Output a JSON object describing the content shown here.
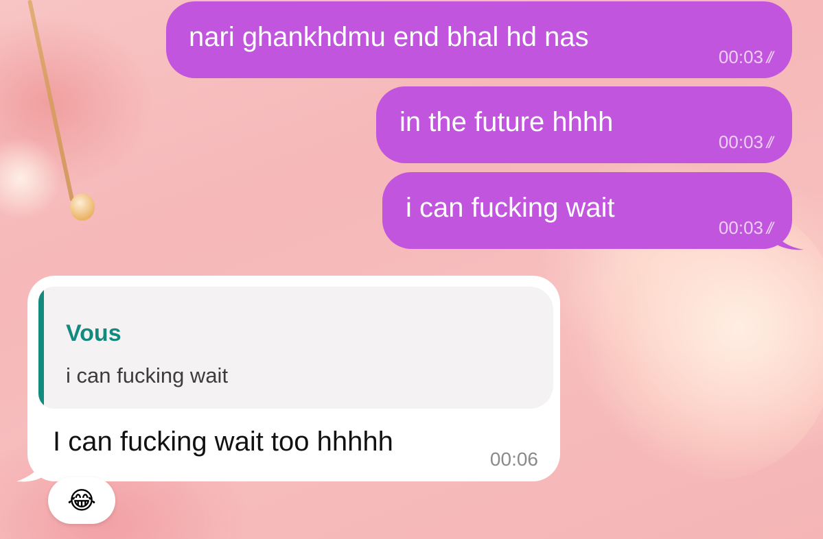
{
  "messages_out": [
    {
      "text": "nari ghankhdmu end bhal hd nas",
      "time": "00:03",
      "status": "read"
    },
    {
      "text": "in the future hhhh",
      "time": "00:03",
      "status": "read"
    },
    {
      "text": "i can fucking wait",
      "time": "00:03",
      "status": "read"
    }
  ],
  "message_in": {
    "quote": {
      "author": "Vous",
      "text": "i can fucking wait"
    },
    "text": "I can fucking wait too hhhhh",
    "time": "00:06",
    "reaction": "😂"
  },
  "colors": {
    "outgoing_bubble": "#c155dd",
    "incoming_bubble": "#ffffff",
    "quote_accent": "#138a7e",
    "background": "#f7bdbd"
  },
  "icons": {
    "read_receipt": "double-check-icon",
    "reaction": "tears-of-joy-emoji"
  }
}
